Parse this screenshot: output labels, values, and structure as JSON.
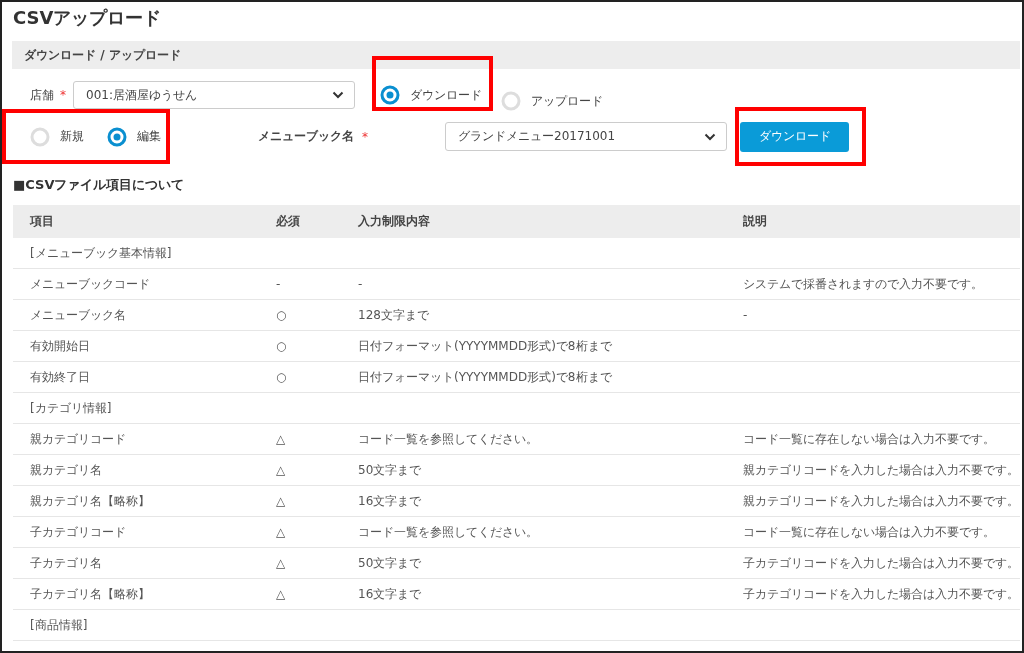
{
  "page": {
    "title": "CSVアップロード"
  },
  "section_bar": {
    "title": "ダウンロード / アップロード"
  },
  "store_field": {
    "label": "店舗",
    "required_mark": "*",
    "value": "001:居酒屋ゆうせん"
  },
  "direction_options": [
    {
      "label": "ダウンロード",
      "selected": true,
      "highlighted": true
    },
    {
      "label": "アップロード",
      "selected": false,
      "highlighted": false
    }
  ],
  "mode_options": {
    "highlighted": true,
    "items": [
      {
        "label": "新規",
        "selected": false
      },
      {
        "label": "編集",
        "selected": true
      }
    ]
  },
  "menubook_field": {
    "label": "メニューブック名",
    "required_mark": "*",
    "value": "グランドメニュー20171001"
  },
  "download_button": {
    "label": "ダウンロード",
    "highlighted": true
  },
  "items_heading": "■CSVファイル項目について",
  "table": {
    "columns": [
      "項目",
      "必須",
      "入力制限内容",
      "説明"
    ],
    "rows": [
      {
        "kind": "section",
        "cells": [
          "[メニューブック基本情報]"
        ]
      },
      {
        "kind": "item",
        "cells": [
          "メニューブックコード",
          "-",
          "-",
          "システムで採番されますので入力不要です。"
        ]
      },
      {
        "kind": "item",
        "cells": [
          "メニューブック名",
          "○",
          "128文字まで",
          "-"
        ]
      },
      {
        "kind": "item",
        "cells": [
          "有効開始日",
          "○",
          "日付フォーマット(YYYYMMDD形式)で8桁まで",
          ""
        ]
      },
      {
        "kind": "item",
        "cells": [
          "有効終了日",
          "○",
          "日付フォーマット(YYYYMMDD形式)で8桁まで",
          ""
        ]
      },
      {
        "kind": "section",
        "cells": [
          "[カテゴリ情報]"
        ]
      },
      {
        "kind": "item",
        "cells": [
          "親カテゴリコード",
          "△",
          "コード一覧を参照してください。",
          "コード一覧に存在しない場合は入力不要です。"
        ]
      },
      {
        "kind": "item",
        "cells": [
          "親カテゴリ名",
          "△",
          "50文字まで",
          "親カテゴリコードを入力した場合は入力不要です。"
        ]
      },
      {
        "kind": "item",
        "cells": [
          "親カテゴリ名【略称】",
          "△",
          "16文字まで",
          "親カテゴリコードを入力した場合は入力不要です。"
        ]
      },
      {
        "kind": "item",
        "cells": [
          "子カテゴリコード",
          "△",
          "コード一覧を参照してください。",
          "コード一覧に存在しない場合は入力不要です。"
        ]
      },
      {
        "kind": "item",
        "cells": [
          "子カテゴリ名",
          "△",
          "50文字まで",
          "子カテゴリコードを入力した場合は入力不要です。"
        ]
      },
      {
        "kind": "item",
        "cells": [
          "子カテゴリ名【略称】",
          "△",
          "16文字まで",
          "子カテゴリコードを入力した場合は入力不要です。"
        ]
      },
      {
        "kind": "section",
        "cells": [
          "[商品情報]"
        ]
      }
    ]
  }
}
